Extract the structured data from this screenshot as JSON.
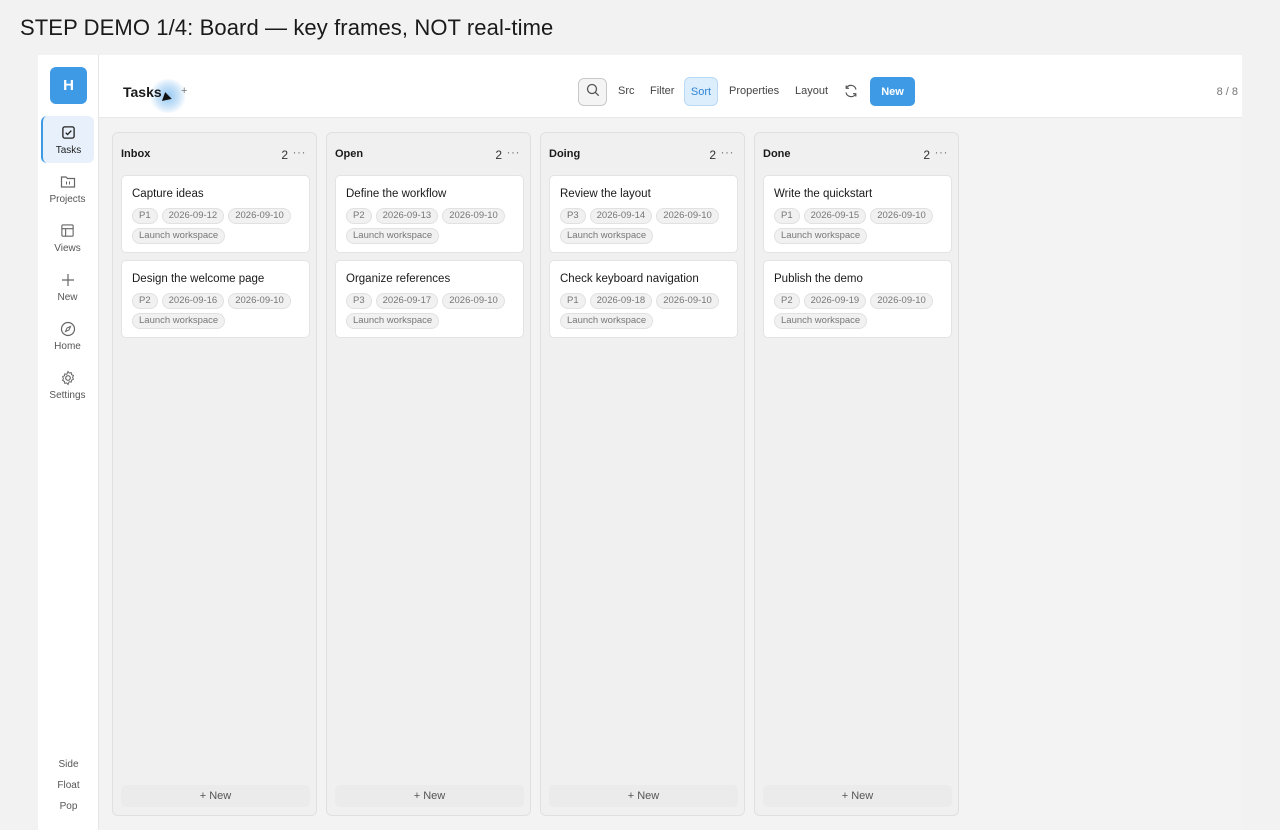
{
  "caption": "STEP DEMO 1/4: Board — key frames, NOT real-time",
  "sidebar": {
    "avatar": "H",
    "items": [
      {
        "label": "Tasks",
        "icon": "check-square-icon",
        "active": true
      },
      {
        "label": "Projects",
        "icon": "folder-icon",
        "active": false
      },
      {
        "label": "Views",
        "icon": "layout-icon",
        "active": false
      },
      {
        "label": "New",
        "icon": "plus-icon",
        "active": false
      },
      {
        "label": "Home",
        "icon": "compass-icon",
        "active": false
      },
      {
        "label": "Settings",
        "icon": "gear-icon",
        "active": false
      }
    ],
    "modes": [
      "Side",
      "Float",
      "Pop"
    ]
  },
  "topbar": {
    "title": "Tasks",
    "title_add": "+",
    "search_icon": "search-icon",
    "src": "Src",
    "filter": "Filter",
    "sort": "Sort",
    "properties": "Properties",
    "layout": "Layout",
    "refresh_icon": "refresh-icon",
    "new": "New",
    "page_count": "8 / 8"
  },
  "columns": [
    {
      "name": "Inbox",
      "count": "2",
      "more": "···",
      "new_label": "+ New",
      "cards": [
        {
          "title": "Capture ideas",
          "priority": "P1",
          "date1": "2026-09-12",
          "date2": "2026-09-10",
          "project": "Launch workspace"
        },
        {
          "title": "Design the welcome page",
          "priority": "P2",
          "date1": "2026-09-16",
          "date2": "2026-09-10",
          "project": "Launch workspace"
        }
      ]
    },
    {
      "name": "Open",
      "count": "2",
      "more": "···",
      "new_label": "+ New",
      "cards": [
        {
          "title": "Define the workflow",
          "priority": "P2",
          "date1": "2026-09-13",
          "date2": "2026-09-10",
          "project": "Launch workspace"
        },
        {
          "title": "Organize references",
          "priority": "P3",
          "date1": "2026-09-17",
          "date2": "2026-09-10",
          "project": "Launch workspace"
        }
      ]
    },
    {
      "name": "Doing",
      "count": "2",
      "more": "···",
      "new_label": "+ New",
      "cards": [
        {
          "title": "Review the layout",
          "priority": "P3",
          "date1": "2026-09-14",
          "date2": "2026-09-10",
          "project": "Launch workspace"
        },
        {
          "title": "Check keyboard navigation",
          "priority": "P1",
          "date1": "2026-09-18",
          "date2": "2026-09-10",
          "project": "Launch workspace"
        }
      ]
    },
    {
      "name": "Done",
      "count": "2",
      "more": "···",
      "new_label": "+ New",
      "cards": [
        {
          "title": "Write the quickstart",
          "priority": "P1",
          "date1": "2026-09-15",
          "date2": "2026-09-10",
          "project": "Launch workspace"
        },
        {
          "title": "Publish the demo",
          "priority": "P2",
          "date1": "2026-09-19",
          "date2": "2026-09-10",
          "project": "Launch workspace"
        }
      ]
    }
  ],
  "colors": {
    "accent": "#3f9ae6",
    "sort_bg": "#dceefc"
  }
}
